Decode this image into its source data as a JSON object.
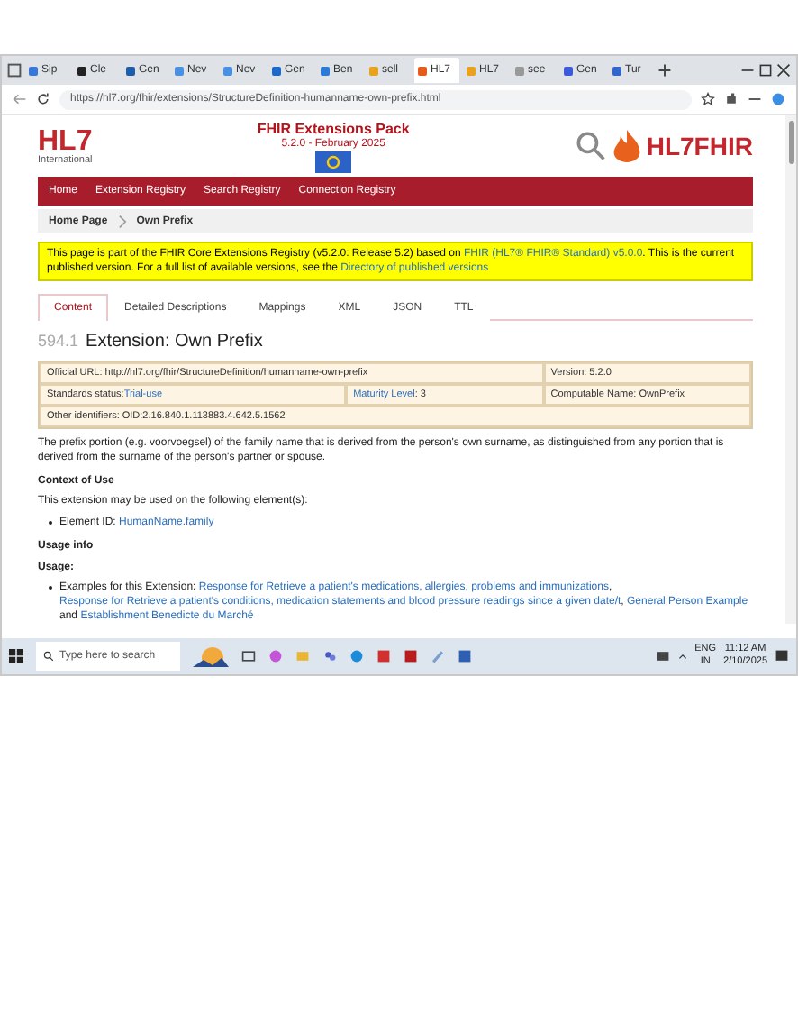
{
  "browser": {
    "tabs": [
      {
        "label": "Sip",
        "selected": false
      },
      {
        "label": "Cle",
        "selected": false
      },
      {
        "label": "Gen",
        "selected": false
      },
      {
        "label": "Nev",
        "selected": false
      },
      {
        "label": "Nev",
        "selected": false
      },
      {
        "label": "Gen",
        "selected": false
      },
      {
        "label": "Ben",
        "selected": false
      },
      {
        "label": "sell",
        "selected": false
      },
      {
        "label": "HL7",
        "selected": true
      },
      {
        "label": "HL7",
        "selected": false
      },
      {
        "label": "see",
        "selected": false
      },
      {
        "label": "Gen",
        "selected": false
      },
      {
        "label": "Tur",
        "selected": false
      }
    ],
    "url": "https://hl7.org/fhir/extensions/StructureDefinition-humanname-own-prefix.html"
  },
  "header": {
    "logo": "HL7",
    "logo_sub": "International",
    "title": "FHIR Extensions Pack",
    "version": "5.2.0 - February 2025",
    "fhir_logo": "HL7FHIR"
  },
  "nav": [
    "Home",
    "Extension Registry",
    "Search Registry",
    "Connection Registry"
  ],
  "breadcrumb": [
    "Home Page",
    "Own Prefix"
  ],
  "banner": {
    "text": "This page is part of the FHIR Core Extensions Registry (v5.2.0: Release 5.2) based on ",
    "link1": "FHIR (HL7® FHIR® Standard) v5.0.0",
    "text2": ". This is the current published version. For a full list of available versions, see the ",
    "link2": "Directory of published versions"
  },
  "page_tabs": [
    {
      "label": "Content",
      "selected": true
    },
    {
      "label": "Detailed Descriptions",
      "selected": false
    },
    {
      "label": "Mappings",
      "selected": false
    },
    {
      "label": "XML",
      "selected": false
    },
    {
      "label": "JSON",
      "selected": false
    },
    {
      "label": "TTL",
      "selected": false
    }
  ],
  "title": {
    "number": "594.1",
    "text": "Extension: Own Prefix"
  },
  "info": {
    "official_url": "Official URL: http://hl7.org/fhir/StructureDefinition/humanname-own-prefix",
    "version": "Version: 5.2.0",
    "status_label": "Standards status: ",
    "status": "Trial-use",
    "maturity_label": "Maturity Level",
    "maturity": ": 3",
    "computable": "Computable Name: OwnPrefix",
    "other": "Other identifiers: OID:2.16.840.1.113883.4.642.5.1562"
  },
  "description": "The prefix portion (e.g. voorvoegsel) of the family name that is derived from the person's own surname, as distinguished from any portion that is derived from the surname of the person's partner or spouse.",
  "context_heading": "Context of Use",
  "context_text": "This extension may be used on the following element(s):",
  "element_label": "Element ID: ",
  "element_link": "HumanName.family",
  "usage_info": "Usage info",
  "usage": "Usage:",
  "examples_label": "Examples for this Extension: ",
  "examples": [
    {
      "text": "Response for Retrieve a patient's medications, allergies, problems and immunizations",
      "sep": ", "
    },
    {
      "text": "Response for Retrieve a patient's conditions, medication statements and blood pressure readings since a given date/t",
      "sep": ", "
    },
    {
      "text": "General Person Example",
      "sep": " and "
    },
    {
      "text": "Establishment Benedicte du Marché"
    }
  ],
  "taskbar": {
    "search_placeholder": "Type here to search",
    "lang": "ENG",
    "region": "IN",
    "time": "11:12 AM",
    "date": "2/10/2025"
  }
}
